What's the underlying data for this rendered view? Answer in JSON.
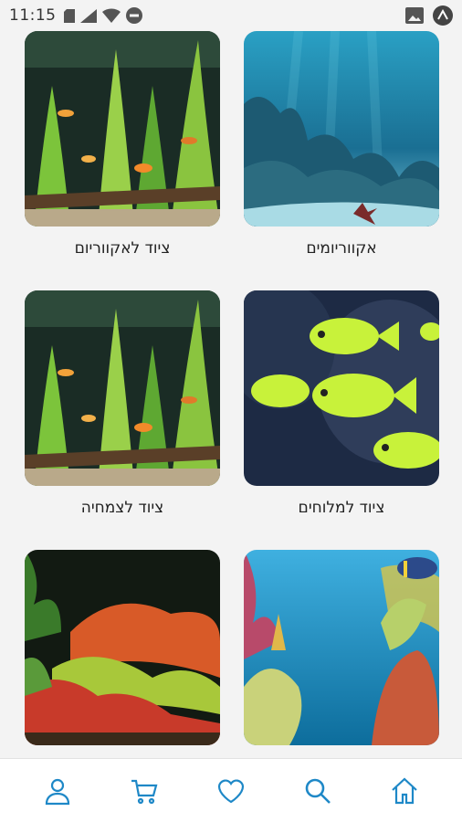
{
  "status_bar": {
    "time": "11:15"
  },
  "categories": [
    {
      "label": "אקווריומים",
      "image": "aquarium-scene-image"
    },
    {
      "label": "ציוד לאקווריום",
      "image": "planted-tank-image"
    },
    {
      "label": "ציוד למלוחים",
      "image": "neon-fish-image"
    },
    {
      "label": "ציוד לצמחיה",
      "image": "planted-tank-image"
    },
    {
      "label": "",
      "image": "coral-reef-image"
    },
    {
      "label": "",
      "image": "red-plants-tank-image"
    }
  ],
  "bottom_nav": [
    {
      "name": "home",
      "icon": "home-icon"
    },
    {
      "name": "search",
      "icon": "search-icon"
    },
    {
      "name": "favorites",
      "icon": "heart-icon"
    },
    {
      "name": "cart",
      "icon": "cart-icon"
    },
    {
      "name": "profile",
      "icon": "user-icon"
    }
  ],
  "colors": {
    "accent": "#1e88c7",
    "background": "#f3f3f3"
  }
}
